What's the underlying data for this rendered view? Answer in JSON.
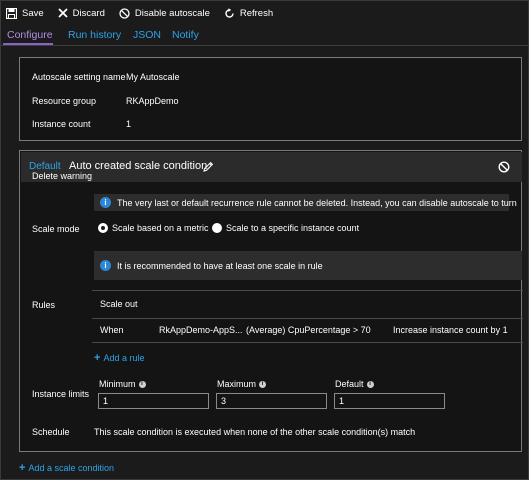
{
  "toolbar": {
    "save": "Save",
    "discard": "Discard",
    "disable": "Disable autoscale",
    "refresh": "Refresh"
  },
  "tabs": [
    {
      "label": "Configure",
      "active": true
    },
    {
      "label": "Run history"
    },
    {
      "label": "JSON"
    },
    {
      "label": "Notify"
    }
  ],
  "setting": {
    "name_label": "Autoscale setting name",
    "name_value": "My Autoscale",
    "rg_label": "Resource group",
    "rg_value": "RKAppDemo",
    "count_label": "Instance count",
    "count_value": "1"
  },
  "condition": {
    "badge": "Default",
    "title": "Auto created scale condition",
    "delete_warning_label": "Delete warning",
    "delete_warning_text": "The very last or default recurrence rule cannot be deleted. Instead, you can disable autoscale to turn",
    "scale_mode_label": "Scale mode",
    "scale_mode_options": [
      "Scale based on a metric",
      "Scale to a specific instance count"
    ],
    "scale_mode_selected": "Scale based on a metric",
    "recommend_text": "It is recommended to have at least one scale in rule",
    "rules_label": "Rules",
    "rules_header": "Scale out",
    "rule_row": {
      "when": "When",
      "resource": "RkAppDemo-AppS...",
      "metric": "(Average) CpuPercentage > 70",
      "action": "Increase instance count by 1"
    },
    "add_rule": "Add a rule",
    "instance_limits_label": "Instance limits",
    "minimum_label": "Minimum",
    "minimum_value": "1",
    "maximum_label": "Maximum",
    "maximum_value": "3",
    "default_label": "Default",
    "default_value": "1",
    "schedule_label": "Schedule",
    "schedule_text": "This scale condition is executed when none of the other scale condition(s) match"
  },
  "add_condition": "Add a scale condition",
  "colors": {
    "accent_blue": "#2ea3e8",
    "active_tab": "#b48be6",
    "info_blue": "#2b87d8",
    "background": "#1b1b1b"
  }
}
